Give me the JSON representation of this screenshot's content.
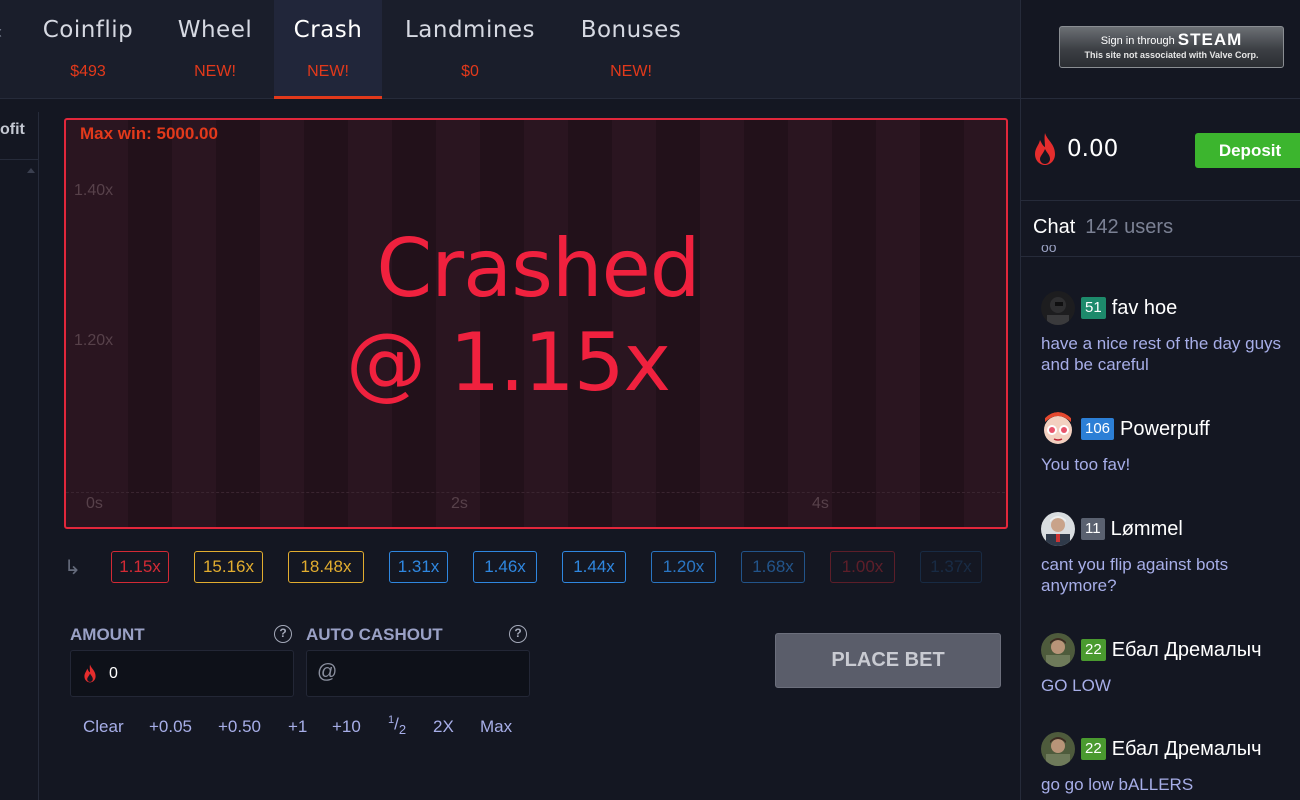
{
  "nav": {
    "tabs": [
      {
        "label": "Coinflip",
        "sub": "$493"
      },
      {
        "label": "Wheel",
        "sub": "NEW!"
      },
      {
        "label": "Crash",
        "sub": "NEW!",
        "active": true
      },
      {
        "label": "Landmines",
        "sub": "$0"
      },
      {
        "label": "Bonuses",
        "sub": "NEW!"
      }
    ]
  },
  "steam": {
    "line1_prefix": "Sign in through",
    "line1_brand": "STEAM",
    "line2": "This site not associated with Valve Corp."
  },
  "balance": {
    "value": "0.00",
    "deposit_label": "Deposit"
  },
  "chat": {
    "title": "Chat",
    "users": "142 users",
    "messages": [
      {
        "level": "51",
        "level_color": "#1d8a6b",
        "user": "fav hoe",
        "text": "have a nice rest of the day guys and be careful"
      },
      {
        "level": "106",
        "level_color": "#2c7fd6",
        "user": "Powerpuff",
        "text": "You too fav!"
      },
      {
        "level": "11",
        "level_color": "#5a6170",
        "user": "Lømmel",
        "text": "cant you flip against bots anymore?"
      },
      {
        "level": "22",
        "level_color": "#4a9a2f",
        "user": "Ебал Дремалыч",
        "text": "GO LOW"
      },
      {
        "level": "22",
        "level_color": "#4a9a2f",
        "user": "Ебал Дремалыч",
        "text": "go go low bALLERS"
      }
    ]
  },
  "left_strip": {
    "label": "ofit"
  },
  "crash": {
    "max_win": "Max win: 5000.00",
    "y_ticks": [
      "1.40x",
      "1.20x"
    ],
    "x_ticks": [
      "0s",
      "2s",
      "4s"
    ],
    "crashed_line1": "Crashed",
    "crashed_line2": "@ 1.15x"
  },
  "history": [
    {
      "value": "1.15x",
      "color": "#d32a35"
    },
    {
      "value": "15.16x",
      "color": "#e2ad2f"
    },
    {
      "value": "18.48x",
      "color": "#e2ad2f"
    },
    {
      "value": "1.31x",
      "color": "#2f87e0"
    },
    {
      "value": "1.46x",
      "color": "#2f87e0"
    },
    {
      "value": "1.44x",
      "color": "#2f87e0"
    },
    {
      "value": "1.20x",
      "color": "#2f87e0"
    },
    {
      "value": "1.68x",
      "color": "#2f87e0"
    },
    {
      "value": "1.00x",
      "color": "#d32a35"
    },
    {
      "value": "1.37x",
      "color": "#2f87e0"
    }
  ],
  "bet": {
    "amount_label": "AMOUNT",
    "amount_value": "0",
    "auto_cashout_label": "AUTO CASHOUT",
    "cashout_prefix": "@",
    "place_bet_label": "PLACE BET",
    "quick": {
      "clear": "Clear",
      "p005": "+0.05",
      "p050": "+0.50",
      "p1": "+1",
      "p10": "+10",
      "half_num": "1",
      "half_den": "2",
      "double": "2X",
      "max": "Max"
    }
  },
  "colors": {
    "accent": "#e2391b",
    "crash_red": "#f0213e",
    "deposit_green": "#3cb52e"
  }
}
